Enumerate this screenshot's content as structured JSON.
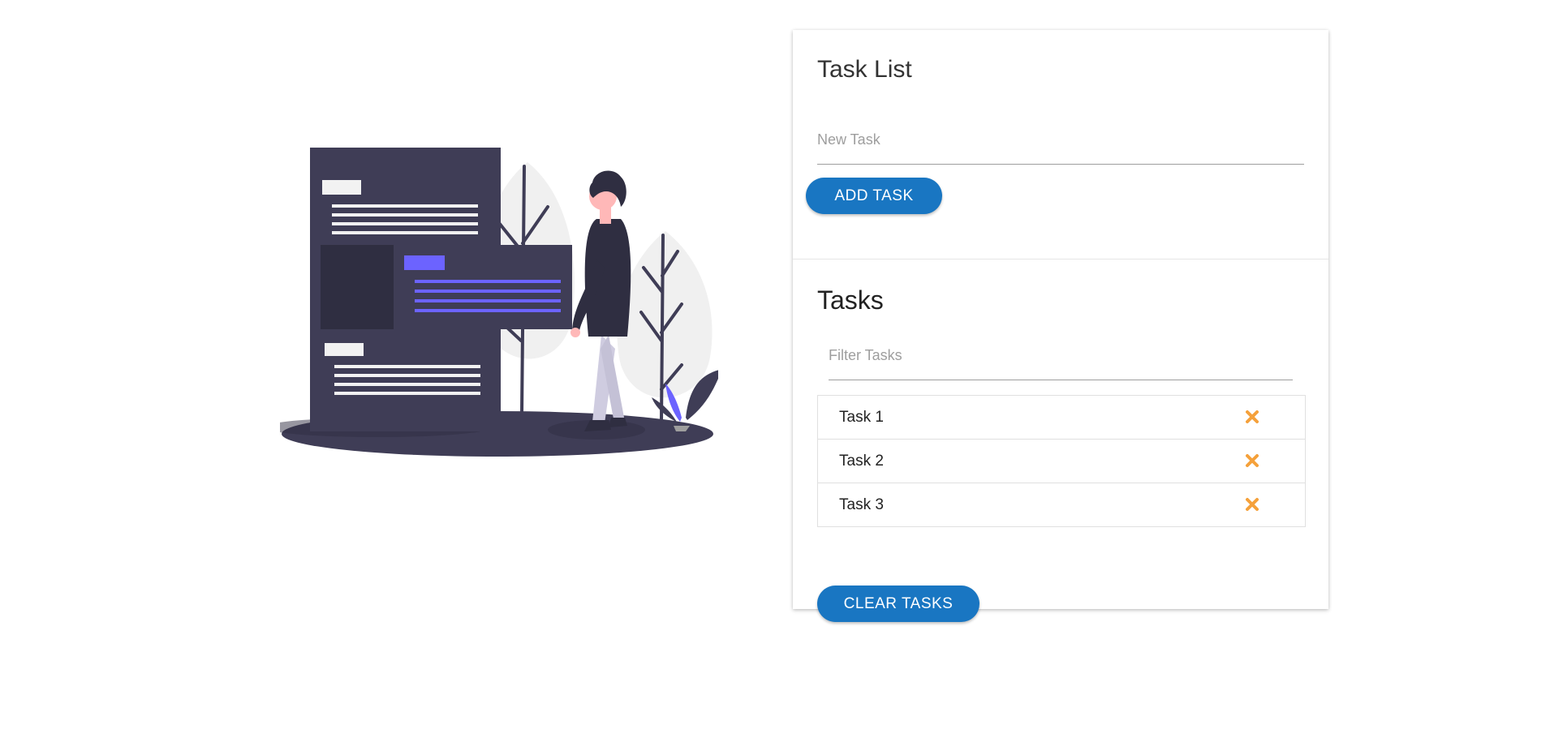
{
  "task_form": {
    "title": "Task List",
    "new_task_placeholder": "New Task",
    "new_task_value": "",
    "add_button_label": "ADD TASK"
  },
  "tasks_section": {
    "title": "Tasks",
    "filter_placeholder": "Filter Tasks",
    "filter_value": "",
    "items": [
      {
        "label": "Task 1",
        "icon": "delete-icon"
      },
      {
        "label": "Task 2",
        "icon": "delete-icon"
      },
      {
        "label": "Task 3",
        "icon": "delete-icon"
      }
    ],
    "clear_button_label": "CLEAR TASKS"
  },
  "colors": {
    "primary": "#1976c2",
    "delete_icon": "#f5a13b",
    "illustration_dark": "#3f3d56",
    "illustration_accent": "#6c63ff"
  }
}
